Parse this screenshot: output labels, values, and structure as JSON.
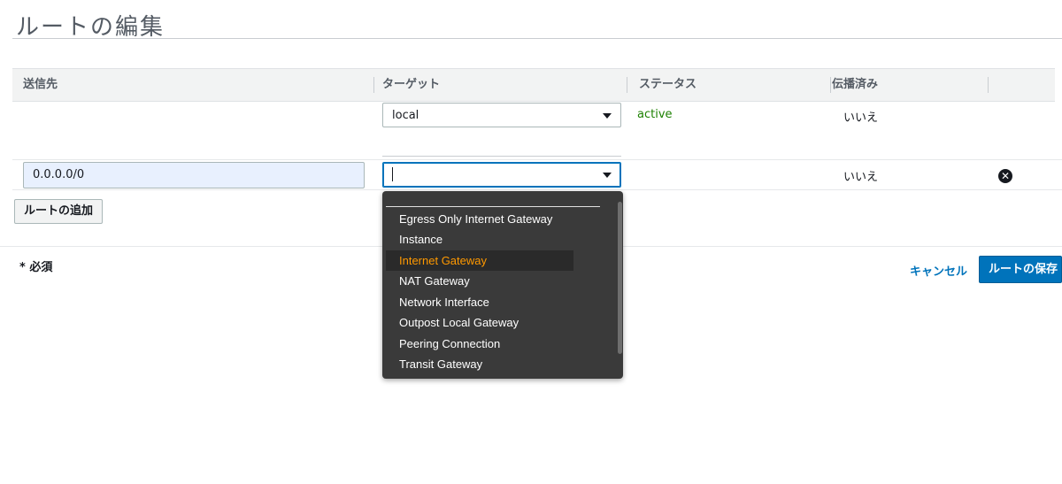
{
  "page": {
    "title": "ルートの編集"
  },
  "table": {
    "headers": {
      "destination": "送信先",
      "target": "ターゲット",
      "status": "ステータス",
      "propagated": "伝播済み"
    },
    "rows": [
      {
        "destination": "",
        "target": "local",
        "status": "active",
        "propagated": "いいえ"
      },
      {
        "destination": "0.0.0.0/0",
        "target": "",
        "status": "",
        "propagated": "いいえ"
      }
    ]
  },
  "dropdown": {
    "options": [
      "Egress Only Internet Gateway",
      "Instance",
      "Internet Gateway",
      "NAT Gateway",
      "Network Interface",
      "Outpost Local Gateway",
      "Peering Connection",
      "Transit Gateway"
    ],
    "highlighted": "Internet Gateway"
  },
  "buttons": {
    "add_route": "ルートの追加",
    "cancel": "キャンセル",
    "save_routes": "ルートの保存",
    "remove_icon": "close-circle-icon"
  },
  "footer": {
    "required_note": "* 必須"
  },
  "colors": {
    "accent": "#0073bb",
    "status_active": "#1d8102",
    "highlight": "#ff9900"
  }
}
